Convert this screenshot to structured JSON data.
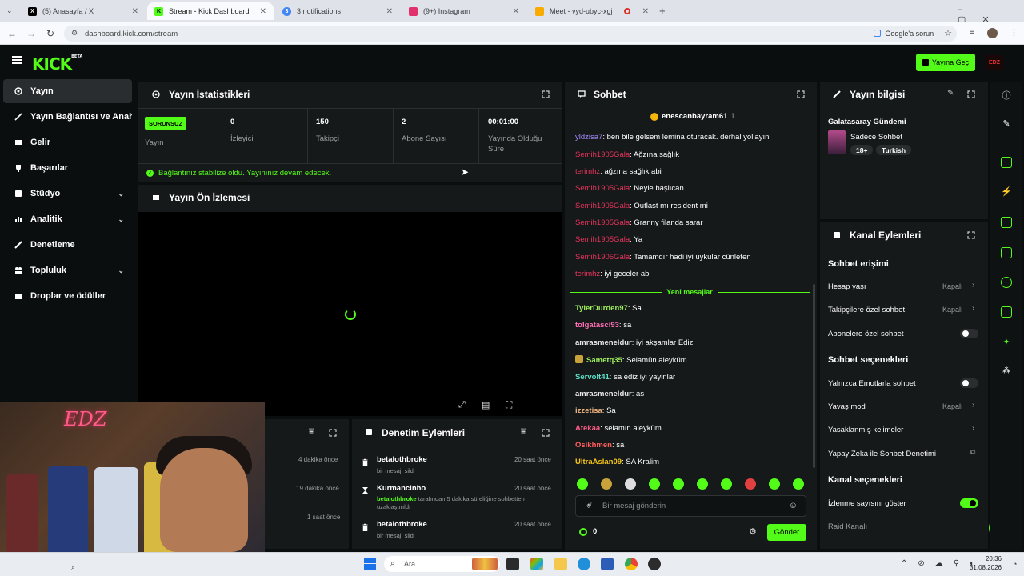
{
  "browser": {
    "tabs": [
      {
        "label": "(5) Anasayfa / X",
        "favicon": "x-logo-icon",
        "color": "#000000"
      },
      {
        "label": "Stream - Kick Dashboard",
        "favicon": "kick-logo-icon",
        "color": "#53fc18"
      },
      {
        "label": "3 notifications",
        "favicon": "notifications-icon",
        "color": "#4285f4"
      },
      {
        "label": "(9+) Instagram",
        "favicon": "instagram-icon",
        "color": "#e1306c"
      },
      {
        "label": "Meet - vyd-ubyc-xgj",
        "favicon": "meet-icon",
        "color": "#f9ab00"
      }
    ],
    "url": "dashboard.kick.com/stream",
    "google_lens": "Google'a sorun"
  },
  "header": {
    "logo": "KICK",
    "beta": "BETA",
    "go_live": "Yayına Geç",
    "avatar_text": "EDZ"
  },
  "sidebar": {
    "items": [
      {
        "label": "Yayın",
        "icon": "broadcast-icon"
      },
      {
        "label": "Yayın Bağlantısı ve Anahtarı",
        "icon": "key-icon"
      },
      {
        "label": "Gelir",
        "icon": "revenue-icon"
      },
      {
        "label": "Başarılar",
        "icon": "trophy-icon"
      },
      {
        "label": "Stüdyo",
        "icon": "studio-icon",
        "chevron": "⌄"
      },
      {
        "label": "Analitik",
        "icon": "analytics-icon",
        "chevron": "⌄"
      },
      {
        "label": "Denetleme",
        "icon": "moderation-icon"
      },
      {
        "label": "Topluluk",
        "icon": "community-icon",
        "chevron": "⌄"
      },
      {
        "label": "Droplar ve ödüller",
        "icon": "gift-icon"
      }
    ]
  },
  "stats": {
    "title": "Yayın İstatistikleri",
    "badge": "SORUNSUZ",
    "items": [
      {
        "value": "",
        "label": "Yayın"
      },
      {
        "value": "0",
        "label": "İzleyici"
      },
      {
        "value": "150",
        "label": "Takipçi"
      },
      {
        "value": "2",
        "label": "Abone Sayısı"
      },
      {
        "value": "00:01:00",
        "label": "Yayında Olduğu Süre"
      }
    ],
    "status_message": "Bağlantınız stabilize oldu. Yayınınız devam edecek."
  },
  "preview": {
    "title": "Yayın Ön İzlemesi"
  },
  "webcam": {
    "neon_sign": "EDZ"
  },
  "events": {
    "times": [
      "4 dakika önce",
      "19 dakika önce",
      "1 saat önce"
    ]
  },
  "moderation": {
    "title": "Denetim Eylemleri",
    "items": [
      {
        "user": "betalothbroke",
        "desc": "bir mesajı sildi",
        "time": "20 saat önce"
      },
      {
        "user": "Kurmancinho",
        "desc_user": "betalothbroke",
        "desc": "tarafından 5 dakika süreliğine sohbetten uzaklaştırıldı",
        "time": "20 saat önce"
      },
      {
        "user": "betalothbroke",
        "desc": "bir mesajı sildi",
        "time": "20 saat önce"
      }
    ]
  },
  "chat": {
    "title": "Sohbet",
    "pinned_user": "enescanbayram61",
    "pinned_count": "1",
    "new_messages_label": "Yeni mesajlar",
    "messages": [
      {
        "user": "yldzisa7",
        "color": "#a58cff",
        "text": "ben bile gelsem lemina oturacak. derhal yollayın"
      },
      {
        "user": "Semih1905Gala",
        "color": "#e8345c",
        "text": "Ağzına sağlık"
      },
      {
        "user": "terimhz",
        "color": "#e8345c",
        "text": "ağzına sağlık abi"
      },
      {
        "user": "Semih1905Gala",
        "color": "#e8345c",
        "text": "Neyle başlıcan"
      },
      {
        "user": "Semih1905Gala",
        "color": "#e8345c",
        "text": "Outlast mı resident mi"
      },
      {
        "user": "Semih1905Gala",
        "color": "#e8345c",
        "text": "Granny filanda sarar"
      },
      {
        "user": "Semih1905Gala",
        "color": "#e8345c",
        "text": "Ya"
      },
      {
        "user": "Semih1905Gala",
        "color": "#e8345c",
        "text": "Tamamdır hadi iyi uykular cünleten"
      },
      {
        "user": "terimhz",
        "color": "#e8345c",
        "text": "iyi geceler abi"
      },
      {
        "user": "TylerDurden97",
        "color": "#9ef05a",
        "text": "Sa"
      },
      {
        "user": "tolgatasci93",
        "color": "#ff6fb5",
        "text": "sa"
      },
      {
        "user": "amrasmeneldur",
        "color": "#e8e8e8",
        "text": "iyi akşamlar Ediz"
      },
      {
        "user": "Sametq35",
        "color": "#9ef05a",
        "text": "Selamün aleyküm"
      },
      {
        "user": "Servolt41",
        "color": "#5ce0c8",
        "text": "sa ediz iyi yayinlar"
      },
      {
        "user": "amrasmeneldur",
        "color": "#e8e8e8",
        "text": "as"
      },
      {
        "user": "izzetisa",
        "color": "#f0b480",
        "text": "Sa"
      },
      {
        "user": "Atekaa",
        "color": "#ff5c8a",
        "text": "selamın aleyküm"
      },
      {
        "user": "Osikhmen",
        "color": "#ff5c5c",
        "text": "sa"
      },
      {
        "user": "UltraAslan09",
        "color": "#f5c518",
        "text": "SA Kralim"
      }
    ],
    "input_placeholder": "Bir mesaj gönderin",
    "viewer_count": "0",
    "send": "Gönder"
  },
  "stream_info": {
    "title": "Yayın bilgisi",
    "stream_title": "Galatasaray Gündemi",
    "category": "Sadece Sohbet",
    "tags": [
      "18+",
      "Turkish"
    ]
  },
  "channel_actions": {
    "title": "Kanal Eylemleri",
    "chat_access": "Sohbet erişimi",
    "rows1": [
      {
        "label": "Hesap yaşı",
        "value": "Kapalı"
      },
      {
        "label": "Takipçilere özel sohbet",
        "value": "Kapalı"
      },
      {
        "label": "Abonelere özel sohbet",
        "toggle": false
      }
    ],
    "chat_options": "Sohbet seçenekleri",
    "rows2": [
      {
        "label": "Yalnızca Emotlarla sohbet",
        "toggle": false
      },
      {
        "label": "Yavaş mod",
        "value": "Kapalı"
      },
      {
        "label": "Yasaklanmış kelimeler"
      },
      {
        "label": "Yapay Zeka ile Sohbet Denetimi"
      }
    ],
    "channel_options": "Kanal seçenekleri",
    "rows3": [
      {
        "label": "İzlenme sayısını göster",
        "toggle": true
      },
      {
        "label": "Raid Kanalı"
      }
    ]
  },
  "taskbar": {
    "search": "Ara",
    "time": "20:36",
    "date": "31.08.2026"
  }
}
